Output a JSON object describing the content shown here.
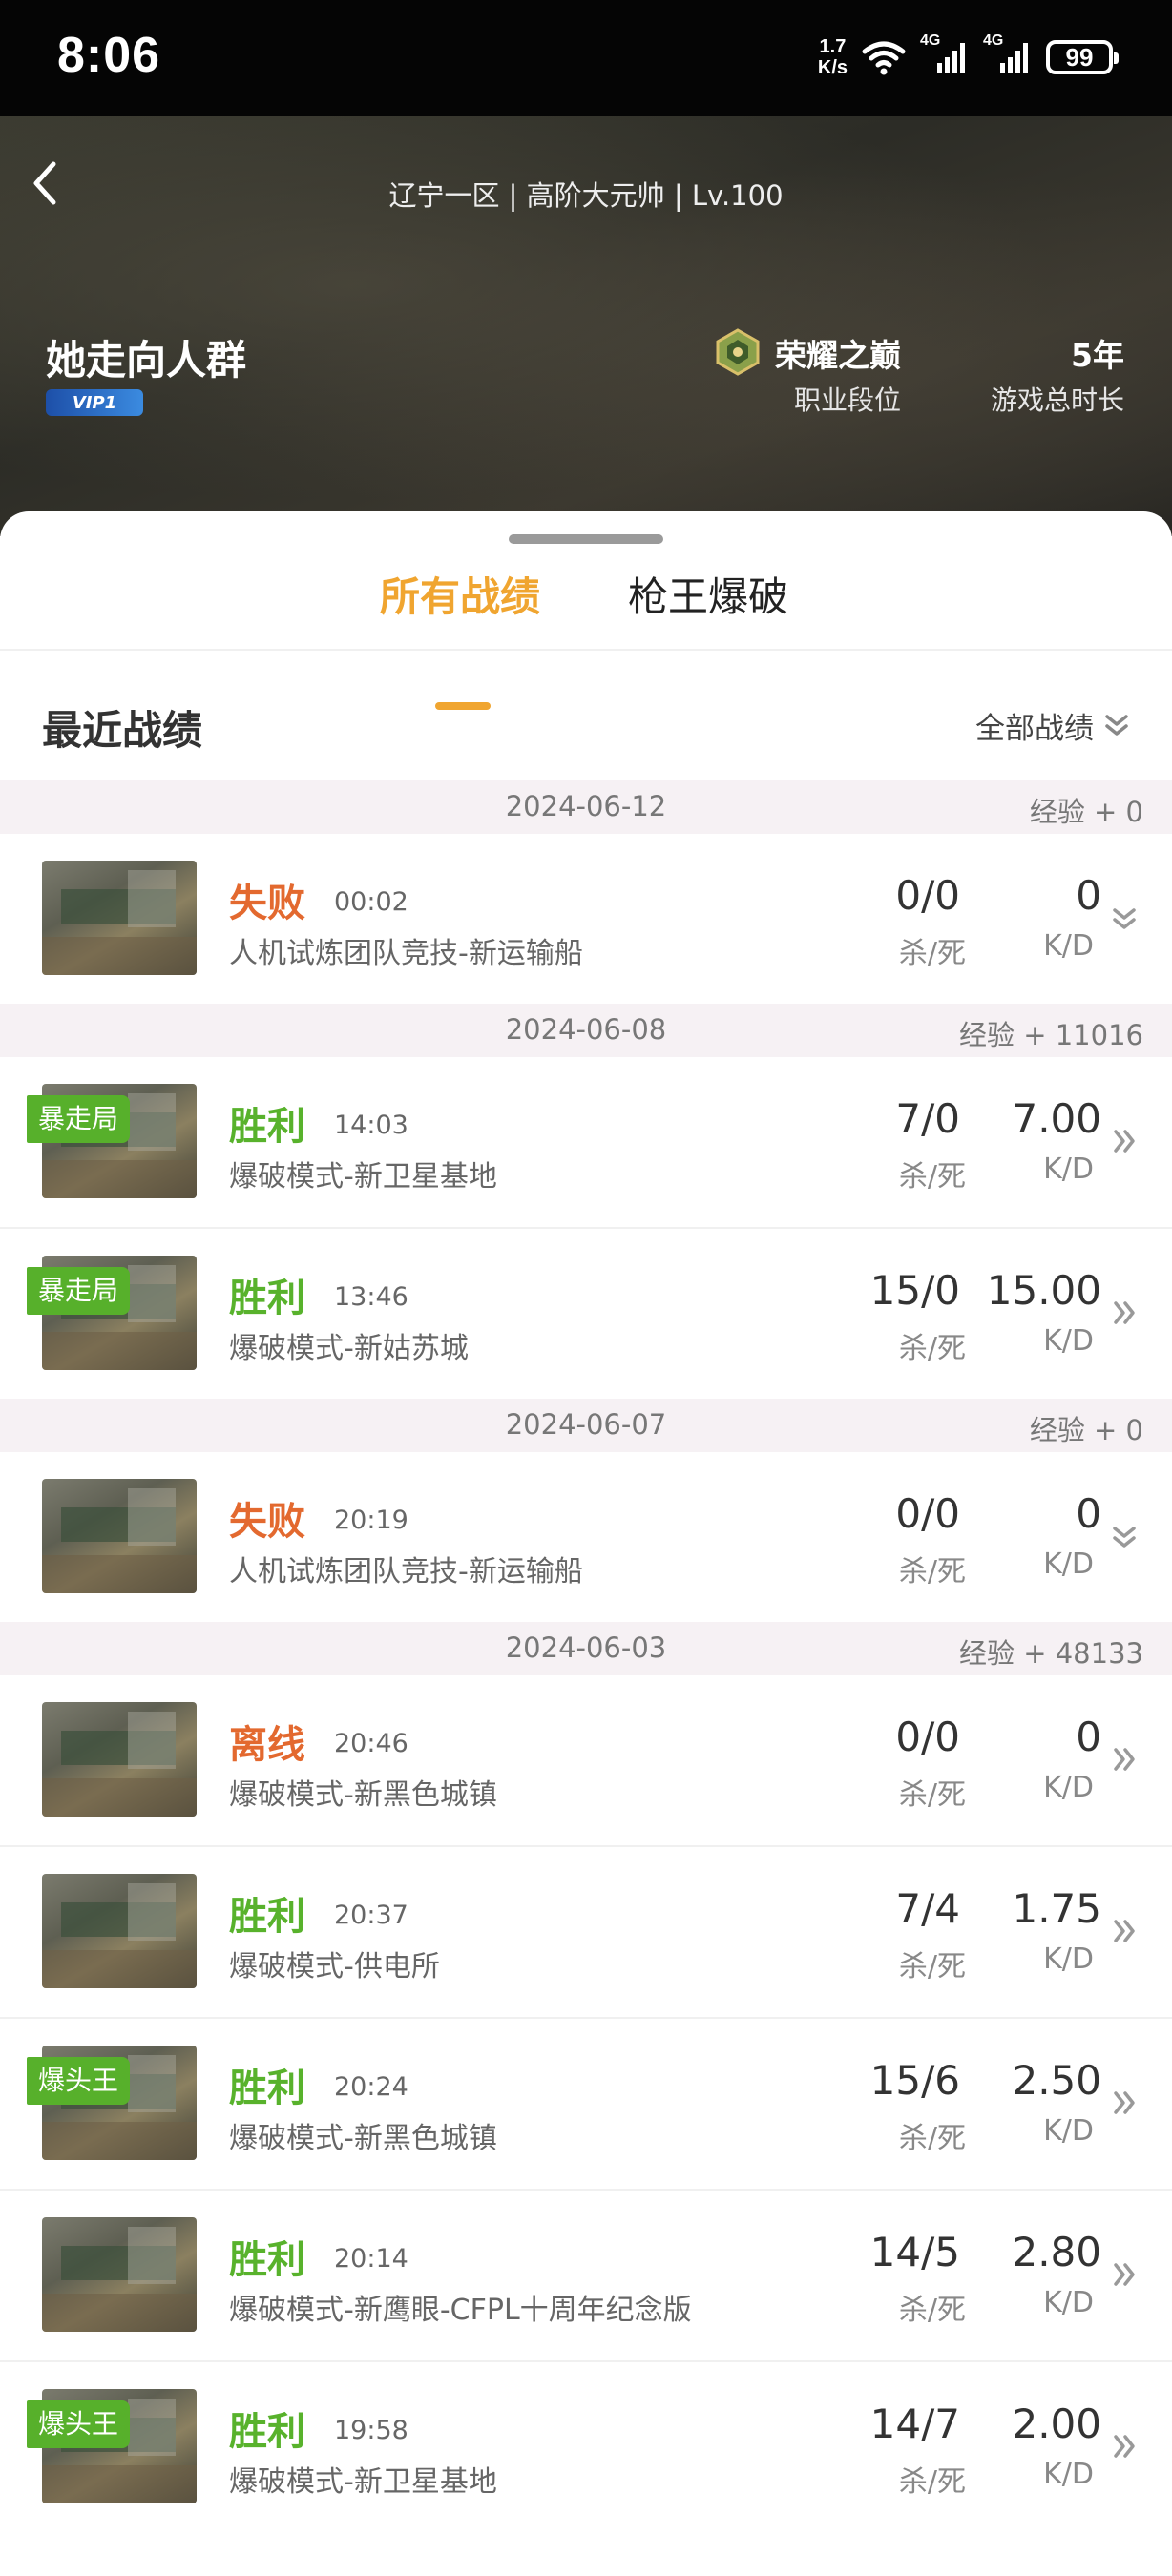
{
  "status_bar": {
    "time": "8:06",
    "net_speed_value": "1.7",
    "net_speed_unit": "K/s",
    "signal1": "4G",
    "signal2": "4G",
    "battery": "99"
  },
  "header": {
    "server_info": "辽宁一区 | 高阶大元帅 | Lv.100",
    "nickname": "她走向人群",
    "vip": "VIP1",
    "rank_name": "荣耀之巅",
    "rank_label": "职业段位",
    "playtime_value": "5年",
    "playtime_label": "游戏总时长"
  },
  "tabs": [
    {
      "label": "所有战绩",
      "active": true
    },
    {
      "label": "枪王爆破",
      "active": false
    }
  ],
  "section": {
    "title": "最近战绩",
    "filter_label": "全部战绩"
  },
  "labels": {
    "kd_ratio": "杀/死",
    "kd_value": "K/D"
  },
  "groups": [
    {
      "date": "2024-06-12",
      "exp": "经验 + 0",
      "matches": [
        {
          "result": "失败",
          "outcome": "lose",
          "time": "00:02",
          "mode": "人机试炼团队竞技-新运输船",
          "kd_ratio": "0/0",
          "kd_value": "0",
          "arrow": "expand"
        }
      ]
    },
    {
      "date": "2024-06-08",
      "exp": "经验 + 11016",
      "matches": [
        {
          "tag": "暴走局",
          "result": "胜利",
          "outcome": "win",
          "time": "14:03",
          "mode": "爆破模式-新卫星基地",
          "kd_ratio": "7/0",
          "kd_value": "7.00",
          "arrow": "more"
        },
        {
          "tag": "暴走局",
          "result": "胜利",
          "outcome": "win",
          "time": "13:46",
          "mode": "爆破模式-新姑苏城",
          "kd_ratio": "15/0",
          "kd_value": "15.00",
          "arrow": "more"
        }
      ]
    },
    {
      "date": "2024-06-07",
      "exp": "经验 + 0",
      "matches": [
        {
          "result": "失败",
          "outcome": "lose",
          "time": "20:19",
          "mode": "人机试炼团队竞技-新运输船",
          "kd_ratio": "0/0",
          "kd_value": "0",
          "arrow": "expand"
        }
      ]
    },
    {
      "date": "2024-06-03",
      "exp": "经验 + 48133",
      "matches": [
        {
          "result": "离线",
          "outcome": "lose",
          "time": "20:46",
          "mode": "爆破模式-新黑色城镇",
          "kd_ratio": "0/0",
          "kd_value": "0",
          "arrow": "more"
        },
        {
          "result": "胜利",
          "outcome": "win",
          "time": "20:37",
          "mode": "爆破模式-供电所",
          "kd_ratio": "7/4",
          "kd_value": "1.75",
          "arrow": "more"
        },
        {
          "tag": "爆头王",
          "result": "胜利",
          "outcome": "win",
          "time": "20:24",
          "mode": "爆破模式-新黑色城镇",
          "kd_ratio": "15/6",
          "kd_value": "2.50",
          "arrow": "more"
        },
        {
          "result": "胜利",
          "outcome": "win",
          "time": "20:14",
          "mode": "爆破模式-新鹰眼-CFPL十周年纪念版",
          "kd_ratio": "14/5",
          "kd_value": "2.80",
          "arrow": "more"
        },
        {
          "tag": "爆头王",
          "result": "胜利",
          "outcome": "win",
          "time": "19:58",
          "mode": "爆破模式-新卫星基地",
          "kd_ratio": "14/7",
          "kd_value": "2.00",
          "arrow": "more"
        }
      ]
    }
  ]
}
